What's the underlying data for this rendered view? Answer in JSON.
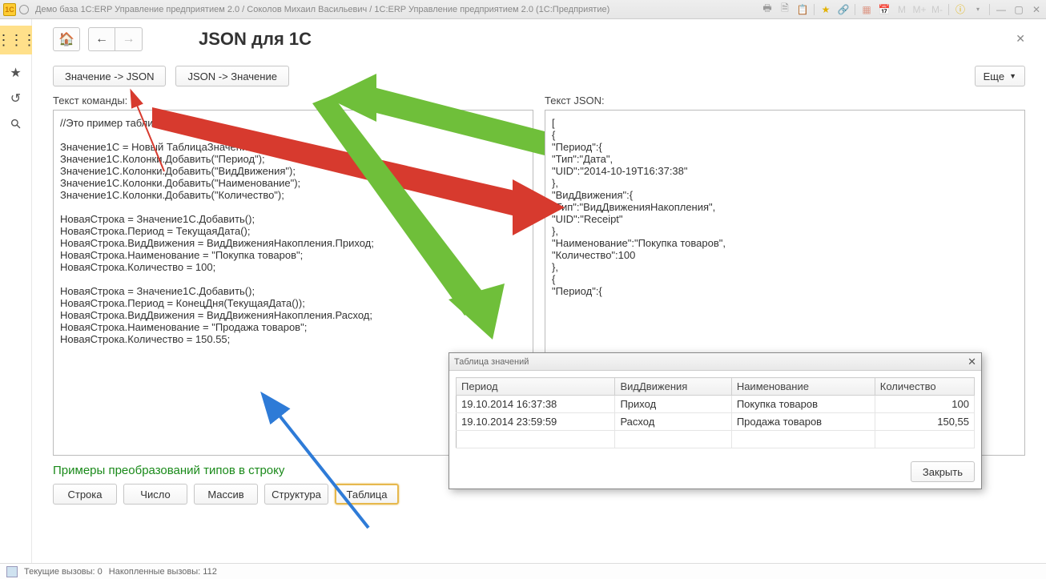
{
  "window": {
    "title": "Демо база 1C:ERP Управление предприятием 2.0 / Соколов Михаил Васильевич / 1C:ERP Управление предприятием 2.0  (1С:Предприятие)"
  },
  "page": {
    "title": "JSON для 1С",
    "btn_value_to_json": "Значение -> JSON",
    "btn_json_to_value": "JSON -> Значение",
    "more": "Еще",
    "label_command": "Текст команды:",
    "label_json": "Текст JSON:",
    "examples_label": "Примеры преобразований типов в строку",
    "example_buttons": [
      "Строка",
      "Число",
      "Массив",
      "Структура",
      "Таблица"
    ]
  },
  "code_command": "//Это пример таблицы\n\nЗначение1С = Новый ТаблицаЗначений;\nЗначение1С.Колонки.Добавить(\"Период\");\nЗначение1С.Колонки.Добавить(\"ВидДвижения\");\nЗначение1С.Колонки.Добавить(\"Наименование\");\nЗначение1С.Колонки.Добавить(\"Количество\");\n\nНоваяСтрока = Значение1С.Добавить();\nНоваяСтрока.Период = ТекущаяДата();\nНоваяСтрока.ВидДвижения = ВидДвиженияНакопления.Приход;\nНоваяСтрока.Наименование = \"Покупка товаров\";\nНоваяСтрока.Количество = 100;\n\nНоваяСтрока = Значение1С.Добавить();\nНоваяСтрока.Период = КонецДня(ТекущаяДата());\nНоваяСтрока.ВидДвижения = ВидДвиженияНакопления.Расход;\nНоваяСтрока.Наименование = \"Продажа товаров\";\nНоваяСтрока.Количество = 150.55;",
  "code_json": "[\n{\n\"Период\":{\n\"Тип\":\"Дата\",\n\"UID\":\"2014-10-19T16:37:38\"\n},\n\"ВидДвижения\":{\n\"Тип\":\"ВидДвиженияНакопления\",\n\"UID\":\"Receipt\"\n},\n\"Наименование\":\"Покупка товаров\",\n\"Количество\":100\n},\n{\n\"Период\":{\n\n\n\n\n\n\n\n\n\n\n\n]",
  "dialog": {
    "title": "Таблица значений",
    "close": "Закрыть",
    "columns": [
      "Период",
      "ВидДвижения",
      "Наименование",
      "Количество"
    ],
    "rows": [
      {
        "period": "19.10.2014 16:37:38",
        "kind": "Приход",
        "name": "Покупка товаров",
        "qty": "100"
      },
      {
        "period": "19.10.2014 23:59:59",
        "kind": "Расход",
        "name": "Продажа товаров",
        "qty": "150,55"
      }
    ]
  },
  "status": {
    "calls": "Текущие вызовы: 0",
    "accum": "Накопленные вызовы: 112"
  }
}
